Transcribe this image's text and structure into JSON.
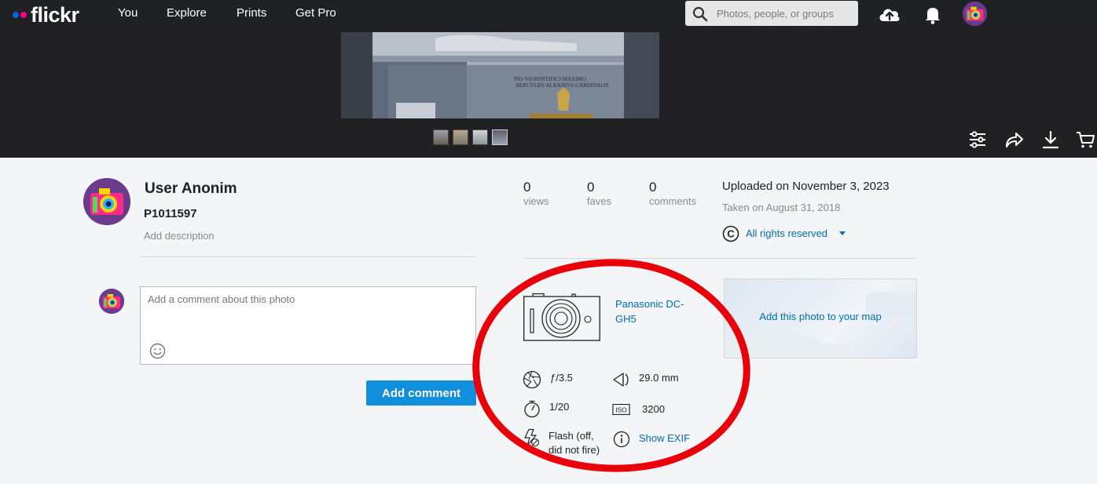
{
  "nav": {
    "logo_text": "flickr",
    "links": [
      "You",
      "Explore",
      "Prints",
      "Get Pro"
    ],
    "search_placeholder": "Photos, people, or groups",
    "icons": [
      "upload-cloud-icon",
      "bell-icon",
      "avatar"
    ]
  },
  "stage": {
    "thumbnails": 4,
    "actions": [
      "adjust-sliders-icon",
      "share-icon",
      "download-icon",
      "cart-icon"
    ]
  },
  "owner": {
    "name": "User Anonim",
    "photo_title": "P1011597",
    "add_description": "Add description"
  },
  "stats": [
    {
      "value": "0",
      "label": "views"
    },
    {
      "value": "0",
      "label": "faves"
    },
    {
      "value": "0",
      "label": "comments"
    }
  ],
  "dates": {
    "uploaded": "Uploaded on November 3, 2023",
    "taken": "Taken on August 31, 2018"
  },
  "license": {
    "label": "All rights reserved"
  },
  "comment": {
    "placeholder": "Add a comment about this photo",
    "button_label": "Add comment"
  },
  "exif": {
    "camera": "Panasonic DC-GH5",
    "aperture": "ƒ/3.5",
    "focal_length": "29.0 mm",
    "exposure": "1/20",
    "iso": "3200",
    "flash_line1": "Flash (off,",
    "flash_line2": "did not fire)",
    "show_exif": "Show EXIF"
  },
  "map": {
    "label": "Add this photo to your map"
  },
  "colors": {
    "nav_bg": "#202124",
    "link": "#006dac",
    "button": "#128fdc",
    "annotation": "#e8000b"
  }
}
